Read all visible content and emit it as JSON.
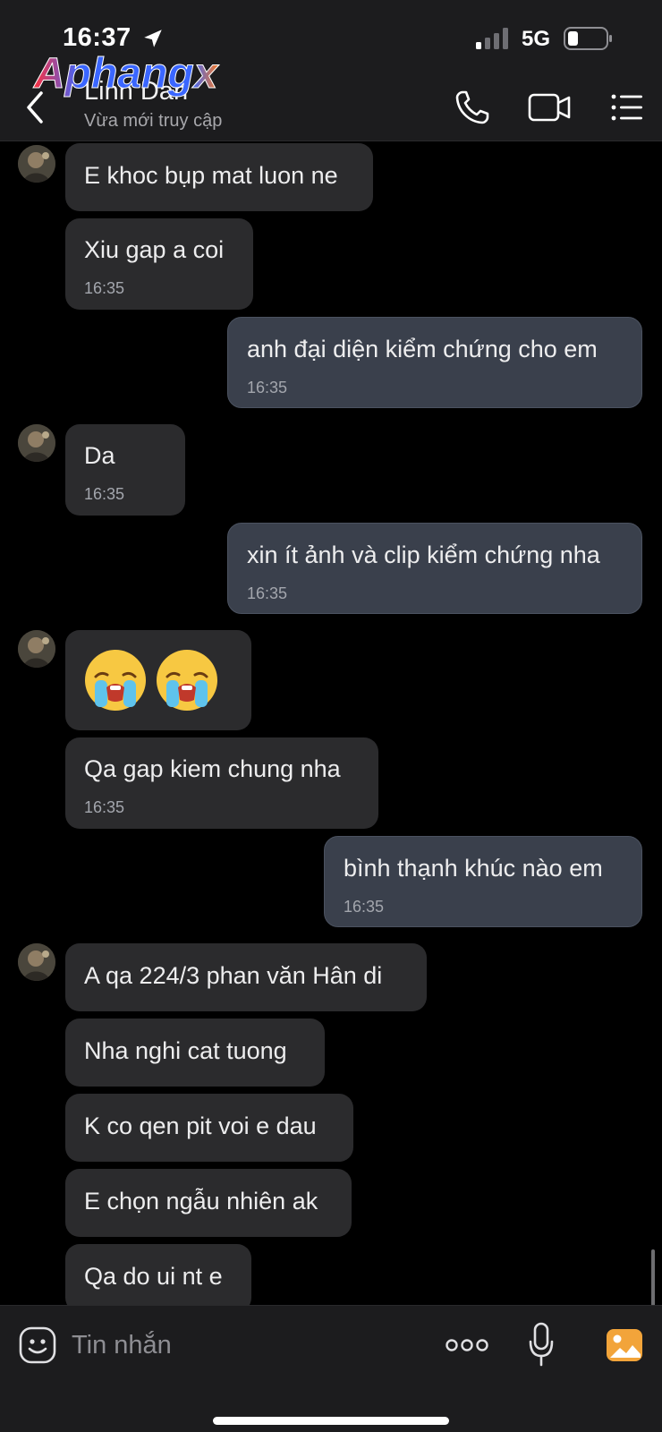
{
  "status_bar": {
    "time": "16:37",
    "network": "5G",
    "icons": [
      "location-arrow-icon",
      "signal-bars-icon",
      "battery-icon"
    ]
  },
  "watermark": {
    "text": "Aphangx"
  },
  "header": {
    "contact_name": "Linh Dan",
    "contact_status": "Vừa mới truy cập",
    "icons": [
      "chevron-left-icon",
      "phone-icon",
      "video-camera-icon",
      "list-menu-icon"
    ]
  },
  "messages": [
    {
      "dir": "in",
      "text": "E khoc bụp mat luon ne",
      "time": ""
    },
    {
      "dir": "in",
      "text": "Xiu gap a coi",
      "time": "16:35"
    },
    {
      "dir": "out",
      "text": "anh đại diện kiểm chứng cho em",
      "time": "16:35"
    },
    {
      "dir": "in",
      "text": "Da",
      "time": "16:35"
    },
    {
      "dir": "out",
      "text": "xin ít ảnh và clip kiểm chứng nha",
      "time": "16:35"
    },
    {
      "dir": "in",
      "emoji": [
        "loudly-crying-face-icon",
        "loudly-crying-face-icon"
      ],
      "time": ""
    },
    {
      "dir": "in",
      "text": "Qa gap kiem chung nha",
      "time": "16:35"
    },
    {
      "dir": "out",
      "text": "bình thạnh khúc nào em",
      "time": "16:35"
    },
    {
      "dir": "in",
      "text": "A qa 224/3 phan văn Hân di",
      "time": ""
    },
    {
      "dir": "in",
      "text": "Nha nghi cat tuong",
      "time": ""
    },
    {
      "dir": "in",
      "text": "K co qen pit voi e dau",
      "time": ""
    },
    {
      "dir": "in",
      "text": "E chọn ngẫu nhiên ak",
      "time": ""
    },
    {
      "dir": "in",
      "text": "Qa do ui nt e",
      "time": ""
    }
  ],
  "composer": {
    "placeholder": "Tin nhắn",
    "icons": [
      "sticker-face-icon",
      "more-dots-icon",
      "microphone-icon",
      "image-gallery-icon"
    ]
  },
  "colors": {
    "background": "#000000",
    "bar": "#1c1c1e",
    "incoming_bubble": "#2b2b2d",
    "outgoing_bubble": "#3a404c",
    "image_button": "#f2a43a"
  }
}
